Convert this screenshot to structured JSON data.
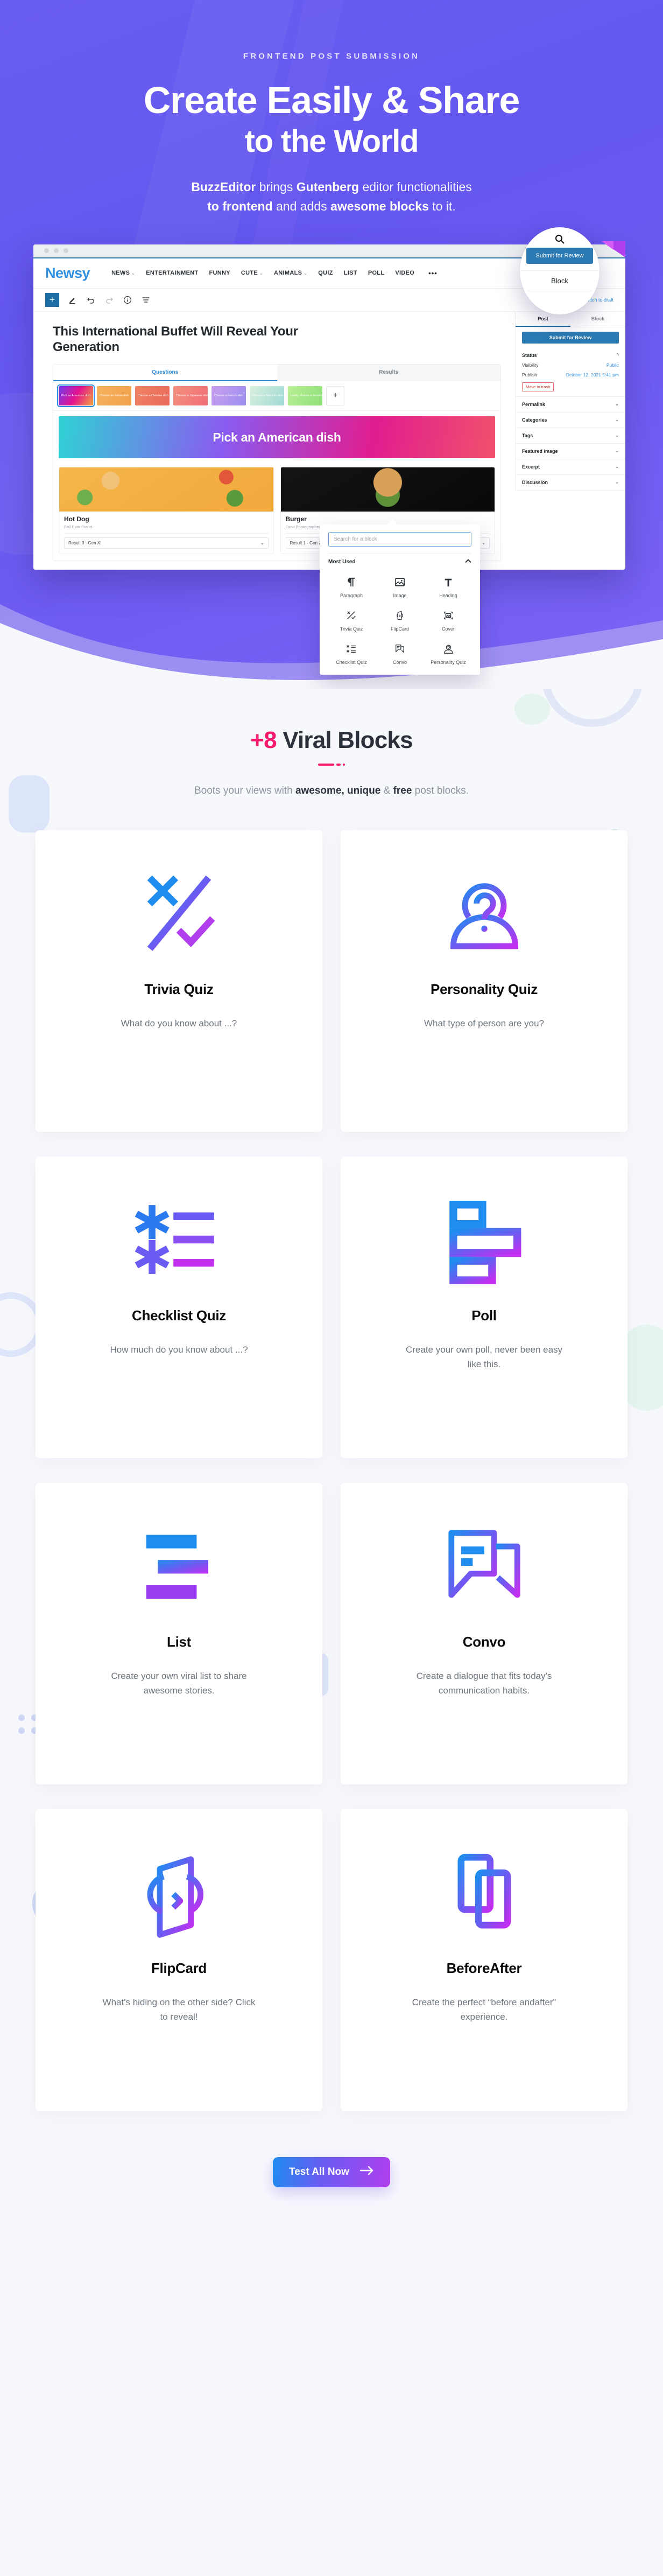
{
  "hero": {
    "eyebrow": "FRONTEND POST SUBMISSION",
    "title_line1": "Create Easily & Share",
    "title_line2": "to the World",
    "sub_1": "BuzzEditor",
    "sub_2": " brings ",
    "sub_3": "Gutenberg",
    "sub_4": " editor functionalities",
    "sub_5": "to frontend",
    "sub_6": " and adds ",
    "sub_7": "awesome blocks",
    "sub_8": " to it."
  },
  "editor": {
    "site_logo": "Newsy",
    "nav": [
      {
        "label": "NEWS",
        "caret": true
      },
      {
        "label": "ENTERTAINMENT",
        "caret": false
      },
      {
        "label": "FUNNY",
        "caret": false
      },
      {
        "label": "CUTE",
        "caret": true
      },
      {
        "label": "ANIMALS",
        "caret": true
      },
      {
        "label": "QUIZ",
        "caret": false
      },
      {
        "label": "LIST",
        "caret": false
      },
      {
        "label": "POLL",
        "caret": false
      },
      {
        "label": "VIDEO",
        "caret": false
      }
    ],
    "nav_more": "•••",
    "toolbar": {
      "add_label": "+",
      "pencil_icon": "pencil-icon",
      "undo_icon": "undo-icon",
      "redo_icon": "redo-icon",
      "info_icon": "info-icon",
      "outline_icon": "outline-icon",
      "switch_link": "Switch to draft"
    },
    "post_title": "This International Buffet Will Reveal Your Generation",
    "quiz": {
      "tabs": [
        "Questions",
        "Results"
      ],
      "active_tab": "Questions",
      "thumbs": [
        {
          "label": "Pick an American dish",
          "selected": true,
          "grad": "linear-gradient(120deg,#6f3df0,#e5128f,#f2a33c)"
        },
        {
          "label": "Choose an Italian dish",
          "selected": false,
          "grad": "linear-gradient(120deg,#f6b35e,#f2a04a)"
        },
        {
          "label": "Choose a Chinese dish",
          "selected": false,
          "grad": "linear-gradient(120deg,#ef8364,#e9695a)"
        },
        {
          "label": "Choose a Japanese dish",
          "selected": false,
          "grad": "linear-gradient(120deg,#f4917f,#ef6d74)"
        },
        {
          "label": "Choose a French dish",
          "selected": false,
          "grad": "linear-gradient(120deg,#c9a0ee,#9b8df0)"
        },
        {
          "label": "Choose a Mexican dish",
          "selected": false,
          "grad": "linear-gradient(120deg,#d9f0de,#9fd9d4)"
        },
        {
          "label": "Lastly, choose a dessert",
          "selected": false,
          "grad": "linear-gradient(120deg,#b9ef94,#8fe07a)"
        }
      ],
      "add_thumb": "+",
      "banner_text": "Pick an American dish",
      "answers": [
        {
          "title": "Hot Dog",
          "sub": "Ball Park Brand",
          "result": "Result 3 - Gen X!",
          "img": "hotdog"
        },
        {
          "title": "Burger",
          "sub": "Food Photographer David",
          "result": "Result 1 - Gen Z!",
          "img": "burger"
        }
      ]
    },
    "sidebar": {
      "tabs": [
        "Post",
        "Block"
      ],
      "active_tab": "Post",
      "submit_button": "Submit for Review",
      "status_header": "Status",
      "visibility_label": "Visibility",
      "visibility_value": "Public",
      "publish_label": "Publish",
      "publish_value": "October 12, 2021 5:41 pm",
      "trash_label": "Move to trash",
      "sections": [
        "Permalink",
        "Categories",
        "Tags",
        "Featured image",
        "Excerpt",
        "Discussion"
      ]
    },
    "magnifier": {
      "search_icon": "search-icon",
      "submit_label": "Submit for Review",
      "block_label": "Block"
    },
    "inserter": {
      "search_placeholder": "Search for a block",
      "section_title": "Most Used",
      "collapse_icon": "chevron-up-icon",
      "items": [
        {
          "label": "Paragraph",
          "icon": "paragraph-icon"
        },
        {
          "label": "Image",
          "icon": "image-icon"
        },
        {
          "label": "Heading",
          "icon": "heading-icon"
        },
        {
          "label": "Trivia Quiz",
          "icon": "trivia-quiz-icon"
        },
        {
          "label": "FlipCard",
          "icon": "flipcard-icon"
        },
        {
          "label": "Cover",
          "icon": "cover-icon"
        },
        {
          "label": "Checklist Quiz",
          "icon": "checklist-quiz-icon"
        },
        {
          "label": "Convo",
          "icon": "convo-icon"
        },
        {
          "label": "Personality Quiz",
          "icon": "personality-quiz-icon"
        }
      ]
    }
  },
  "blocks_section": {
    "title_accent": "+8",
    "title_rest": " Viral Blocks",
    "sub_a": "Boots your views with ",
    "sub_b": "awesome, unique",
    "sub_c": " & ",
    "sub_d": "free",
    "sub_e": " post blocks.",
    "cards": [
      {
        "title": "Trivia Quiz",
        "desc": "What do you know about ...?",
        "icon": "trivia-quiz-icon"
      },
      {
        "title": "Personality Quiz",
        "desc": "What type of person are you?",
        "icon": "personality-quiz-icon"
      },
      {
        "title": "Checklist Quiz",
        "desc": "How much do you know about ...?",
        "icon": "checklist-quiz-icon"
      },
      {
        "title": "Poll",
        "desc": "Create your own poll, never been easy like this.",
        "icon": "poll-icon"
      },
      {
        "title": "List",
        "desc": "Create your own viral list to share awesome stories.",
        "icon": "list-icon"
      },
      {
        "title": "Convo",
        "desc": "Create a dialogue that fits today's communication habits.",
        "icon": "convo-icon"
      },
      {
        "title": "FlipCard",
        "desc": "What's hiding on the other side? Click to reveal!",
        "icon": "flipcard-icon"
      },
      {
        "title": "BeforeAfter",
        "desc": "Create the perfect “before andafter” experience.",
        "icon": "beforeafter-icon"
      }
    ]
  },
  "cta": {
    "label": "Test All Now",
    "arrow_icon": "arrow-right-icon"
  },
  "colors": {
    "hero_purple": "#6a5ef0",
    "accent_pink": "#f5186b",
    "blue": "#2f8fe0",
    "wp_blue": "#2b7ab3",
    "grad_start": "#1f8df0",
    "grad_end": "#b13fee",
    "page_bg": "#f7f8fc"
  }
}
